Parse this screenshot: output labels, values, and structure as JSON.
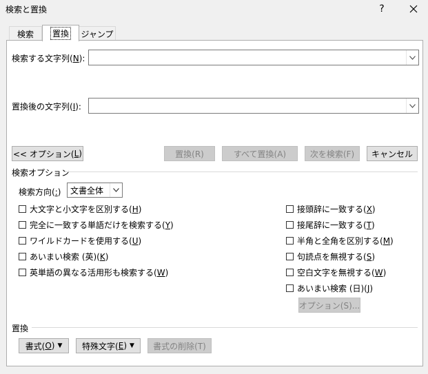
{
  "window": {
    "title": "検索と置換",
    "help": "?"
  },
  "tabs": [
    {
      "label": "検索",
      "active": false
    },
    {
      "label": "置換",
      "active": true
    },
    {
      "label": "ジャンプ",
      "active": false
    }
  ],
  "find": {
    "label_pre": "検索する文字列(",
    "key": "N",
    "label_post": "):",
    "value": ""
  },
  "replace": {
    "label_pre": "置換後の文字列(",
    "key": "I",
    "label_post": "):",
    "value": ""
  },
  "buttons": {
    "options": {
      "pre": "<< オプション(",
      "key": "L",
      "post": ")"
    },
    "replace": "置換(R)",
    "replace_all": "すべて置換(A)",
    "find_next": "次を検索(F)",
    "cancel": "キャンセル"
  },
  "search_options": {
    "heading": "検索オプション",
    "direction": {
      "label_pre": "検索方向(",
      "key": ":",
      "label_post": ")",
      "value": "文書全体"
    },
    "left": [
      {
        "pre": "大文字と小文字を区別する(",
        "key": "H",
        "post": ")",
        "checked": false
      },
      {
        "pre": "完全に一致する単語だけを検索する(",
        "key": "Y",
        "post": ")",
        "checked": false
      },
      {
        "pre": "ワイルドカードを使用する(",
        "key": "U",
        "post": ")",
        "checked": false
      },
      {
        "pre": "あいまい検索 (英)(",
        "key": "K",
        "post": ")",
        "checked": false
      },
      {
        "pre": "英単語の異なる活用形も検索する(",
        "key": "W",
        "post": ")",
        "checked": false
      }
    ],
    "right": [
      {
        "pre": "接頭辞に一致する(",
        "key": "X",
        "post": ")",
        "checked": false
      },
      {
        "pre": "接尾辞に一致する(",
        "key": "T",
        "post": ")",
        "checked": false
      },
      {
        "pre": "半角と全角を区別する(",
        "key": "M",
        "post": ")",
        "checked": false
      },
      {
        "pre": "句読点を無視する(",
        "key": "S",
        "post": ")",
        "checked": false
      },
      {
        "pre": "空白文字を無視する(",
        "key": "W",
        "post": ")",
        "checked": false
      },
      {
        "pre": "あいまい検索 (日)(",
        "key": "J",
        "post": ")",
        "checked": false
      }
    ],
    "options_button": "オプション(S)..."
  },
  "replace_section": {
    "heading": "置換",
    "format": {
      "pre": "書式(",
      "key": "O",
      "post": ")"
    },
    "special": {
      "pre": "特殊文字(",
      "key": "E",
      "post": ")"
    },
    "clear_format": "書式の削除(T)"
  }
}
